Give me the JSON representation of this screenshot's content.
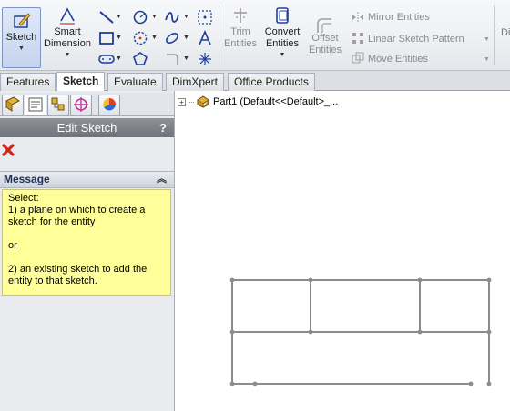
{
  "ribbon": {
    "sketch_label": "Sketch",
    "smart_dimension_label": "Smart\nDimension",
    "trim_label": "Trim\nEntities",
    "convert_label": "Convert\nEntities",
    "offset_label": "Offset\nEntities",
    "mirror_label": "Mirror Entities",
    "linear_pattern_label": "Linear Sketch Pattern",
    "move_label": "Move Entities",
    "cut_label": "Di"
  },
  "tabs": [
    "Features",
    "Sketch",
    "Evaluate",
    "DimXpert",
    "Office Products"
  ],
  "active_tab": "Sketch",
  "panel": {
    "title": "Edit Sketch",
    "help": "?",
    "message_header": "Message",
    "message_lines": [
      "Select:",
      "1) a plane on which to create a sketch for the entity",
      "",
      "or",
      "",
      "2) an existing sketch to add the entity to that sketch."
    ]
  },
  "tree": {
    "root_label": "Part1  (Default<<Default>_..."
  },
  "colors": {
    "message_bg": "#ffff99",
    "title_bar": "#7d8189",
    "sketch_line": "#8c8c8c",
    "icon_blue": "#1f3f9a"
  },
  "sketch": {
    "description": "grid sketch",
    "row1_cells": 3,
    "rows": 2
  }
}
